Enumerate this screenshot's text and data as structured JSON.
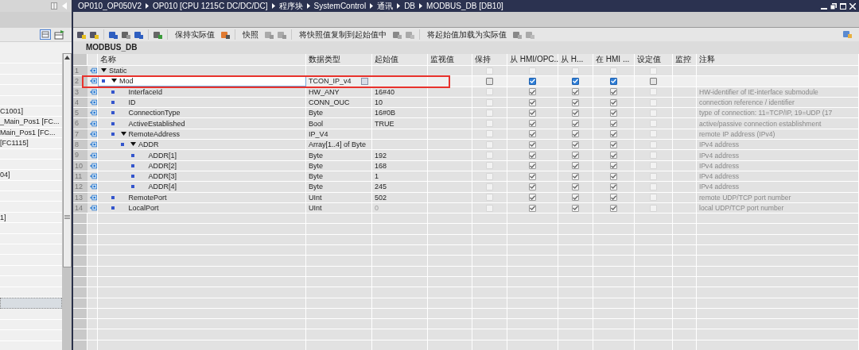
{
  "breadcrumb": [
    "OP010_OP050V2",
    "OP010 [CPU 1215C DC/DC/DC]",
    "程序块",
    "SystemControl",
    "通讯",
    "DB",
    "MODBUS_DB [DB10]"
  ],
  "toolbar": {
    "labels": [
      "保持实际值",
      "快照",
      "将快照值复制到起始值中",
      "将起始值加载为实际值"
    ]
  },
  "left_panel": {
    "items": [
      {
        "kind": "blank",
        "selected": false
      },
      {
        "kind": "blank",
        "selected": false
      },
      {
        "kind": "blank",
        "selected": false
      },
      {
        "kind": "blank",
        "selected": false
      },
      {
        "kind": "blank",
        "selected": false
      },
      {
        "kind": "text",
        "text": "C1001]",
        "selected": false
      },
      {
        "kind": "text",
        "text": "_Main_Pos1 [FC...",
        "selected": false
      },
      {
        "kind": "text",
        "text": "Main_Pos1 [FC...",
        "selected": false
      },
      {
        "kind": "text",
        "text": "[FC1115]",
        "selected": false
      },
      {
        "kind": "blank",
        "selected": false
      },
      {
        "kind": "blank",
        "selected": false
      },
      {
        "kind": "text",
        "text": "04]",
        "selected": false
      },
      {
        "kind": "blank",
        "selected": false
      },
      {
        "kind": "blank",
        "selected": false
      },
      {
        "kind": "blank",
        "selected": false
      },
      {
        "kind": "text",
        "text": "1]",
        "selected": false
      },
      {
        "kind": "blank",
        "selected": false
      },
      {
        "kind": "blank",
        "selected": false
      },
      {
        "kind": "blank",
        "selected": false
      },
      {
        "kind": "blank",
        "selected": false
      },
      {
        "kind": "blank",
        "selected": false
      },
      {
        "kind": "blank",
        "selected": false
      },
      {
        "kind": "blank",
        "selected": false
      },
      {
        "kind": "blank",
        "selected": true
      },
      {
        "kind": "blank",
        "selected": false
      },
      {
        "kind": "blank",
        "selected": false
      },
      {
        "kind": "blank",
        "selected": false
      },
      {
        "kind": "blank",
        "selected": false
      }
    ]
  },
  "editor": {
    "title": "MODBUS_DB",
    "columns": [
      "名称",
      "数据类型",
      "起始值",
      "监视值",
      "保持",
      "从 HMI/OPC..",
      "从 H...",
      "在 HMI ...",
      "设定值",
      "监控",
      "注释"
    ],
    "rows": [
      {
        "num": "1",
        "name": "Static",
        "expanded": true,
        "selected": false,
        "checks": [
          {
            "checked": false,
            "disabled": true
          },
          {
            "checked": false,
            "disabled": true
          },
          {
            "checked": false,
            "disabled": true
          },
          {
            "checked": false,
            "disabled": true
          },
          {
            "checked": false,
            "disabled": true
          }
        ],
        "children": [
          {
            "num": "2",
            "name": "Mod",
            "type": "TCON_IP_v4",
            "expanded": true,
            "selected": true,
            "checks": [
              {
                "checked": false,
                "disabled": false
              },
              {
                "checked": true,
                "disabled": false
              },
              {
                "checked": true,
                "disabled": false
              },
              {
                "checked": true,
                "disabled": false
              },
              {
                "checked": false,
                "disabled": false
              }
            ],
            "children": [
              {
                "num": "3",
                "name": "InterfaceId",
                "type": "HW_ANY",
                "start": "16#40",
                "start_dimmed": false,
                "comment": "HW-identifier of IE-interface submodule",
                "selected": false,
                "checks": [
                  {
                    "checked": false,
                    "disabled": true
                  },
                  {
                    "checked": true,
                    "disabled": true
                  },
                  {
                    "checked": true,
                    "disabled": true
                  },
                  {
                    "checked": true,
                    "disabled": true
                  },
                  {
                    "checked": false,
                    "disabled": true
                  }
                ]
              },
              {
                "num": "4",
                "name": "ID",
                "type": "CONN_OUC",
                "start": "10",
                "start_dimmed": false,
                "comment": "connection reference / identifier",
                "selected": false,
                "checks": [
                  {
                    "checked": false,
                    "disabled": true
                  },
                  {
                    "checked": true,
                    "disabled": true
                  },
                  {
                    "checked": true,
                    "disabled": true
                  },
                  {
                    "checked": true,
                    "disabled": true
                  },
                  {
                    "checked": false,
                    "disabled": true
                  }
                ]
              },
              {
                "num": "5",
                "name": "ConnectionType",
                "type": "Byte",
                "start": "16#0B",
                "start_dimmed": false,
                "comment": "type of connection: 11=TCP/IP, 19=UDP (17",
                "selected": false,
                "checks": [
                  {
                    "checked": false,
                    "disabled": true
                  },
                  {
                    "checked": true,
                    "disabled": true
                  },
                  {
                    "checked": true,
                    "disabled": true
                  },
                  {
                    "checked": true,
                    "disabled": true
                  },
                  {
                    "checked": false,
                    "disabled": true
                  }
                ]
              },
              {
                "num": "6",
                "name": "ActiveEstablished",
                "type": "Bool",
                "start": "TRUE",
                "start_dimmed": false,
                "comment": "active/passive connection establishment",
                "selected": false,
                "checks": [
                  {
                    "checked": false,
                    "disabled": true
                  },
                  {
                    "checked": true,
                    "disabled": true
                  },
                  {
                    "checked": true,
                    "disabled": true
                  },
                  {
                    "checked": true,
                    "disabled": true
                  },
                  {
                    "checked": false,
                    "disabled": true
                  }
                ]
              },
              {
                "num": "7",
                "name": "RemoteAddress",
                "type": "IP_V4",
                "comment": "remote IP address (IPv4)",
                "expanded": true,
                "selected": false,
                "checks": [
                  {
                    "checked": false,
                    "disabled": true
                  },
                  {
                    "checked": true,
                    "disabled": true
                  },
                  {
                    "checked": true,
                    "disabled": true
                  },
                  {
                    "checked": true,
                    "disabled": true
                  },
                  {
                    "checked": false,
                    "disabled": true
                  }
                ],
                "children": [
                  {
                    "num": "8",
                    "name": "ADDR",
                    "type": "Array[1..4] of Byte",
                    "comment": "IPv4 address",
                    "expanded": true,
                    "selected": false,
                    "checks": [
                      {
                        "checked": false,
                        "disabled": true
                      },
                      {
                        "checked": true,
                        "disabled": true
                      },
                      {
                        "checked": true,
                        "disabled": true
                      },
                      {
                        "checked": true,
                        "disabled": true
                      },
                      {
                        "checked": false,
                        "disabled": true
                      }
                    ],
                    "children": [
                      {
                        "num": "9",
                        "name": "ADDR[1]",
                        "type": "Byte",
                        "start": "192",
                        "start_dimmed": false,
                        "comment": "IPv4 address",
                        "selected": false,
                        "checks": [
                          {
                            "checked": false,
                            "disabled": true
                          },
                          {
                            "checked": true,
                            "disabled": true
                          },
                          {
                            "checked": true,
                            "disabled": true
                          },
                          {
                            "checked": true,
                            "disabled": true
                          },
                          {
                            "checked": false,
                            "disabled": true
                          }
                        ]
                      },
                      {
                        "num": "10",
                        "name": "ADDR[2]",
                        "type": "Byte",
                        "start": "168",
                        "start_dimmed": false,
                        "comment": "IPv4 address",
                        "selected": false,
                        "checks": [
                          {
                            "checked": false,
                            "disabled": true
                          },
                          {
                            "checked": true,
                            "disabled": true
                          },
                          {
                            "checked": true,
                            "disabled": true
                          },
                          {
                            "checked": true,
                            "disabled": true
                          },
                          {
                            "checked": false,
                            "disabled": true
                          }
                        ]
                      },
                      {
                        "num": "11",
                        "name": "ADDR[3]",
                        "type": "Byte",
                        "start": "1",
                        "start_dimmed": false,
                        "comment": "IPv4 address",
                        "selected": false,
                        "checks": [
                          {
                            "checked": false,
                            "disabled": true
                          },
                          {
                            "checked": true,
                            "disabled": true
                          },
                          {
                            "checked": true,
                            "disabled": true
                          },
                          {
                            "checked": true,
                            "disabled": true
                          },
                          {
                            "checked": false,
                            "disabled": true
                          }
                        ]
                      },
                      {
                        "num": "12",
                        "name": "ADDR[4]",
                        "type": "Byte",
                        "start": "245",
                        "start_dimmed": false,
                        "comment": "IPv4 address",
                        "selected": false,
                        "checks": [
                          {
                            "checked": false,
                            "disabled": true
                          },
                          {
                            "checked": true,
                            "disabled": true
                          },
                          {
                            "checked": true,
                            "disabled": true
                          },
                          {
                            "checked": true,
                            "disabled": true
                          },
                          {
                            "checked": false,
                            "disabled": true
                          }
                        ]
                      }
                    ]
                  }
                ]
              },
              {
                "num": "13",
                "name": "RemotePort",
                "type": "UInt",
                "start": "502",
                "start_dimmed": false,
                "comment": "remote UDP/TCP port number",
                "selected": false,
                "checks": [
                  {
                    "checked": false,
                    "disabled": true
                  },
                  {
                    "checked": true,
                    "disabled": true
                  },
                  {
                    "checked": true,
                    "disabled": true
                  },
                  {
                    "checked": true,
                    "disabled": true
                  },
                  {
                    "checked": false,
                    "disabled": true
                  }
                ]
              },
              {
                "num": "14",
                "name": "LocalPort",
                "type": "UInt",
                "start": "0",
                "start_dimmed": true,
                "comment": "local UDP/TCP port number",
                "selected": false,
                "checks": [
                  {
                    "checked": false,
                    "disabled": true
                  },
                  {
                    "checked": true,
                    "disabled": true
                  },
                  {
                    "checked": true,
                    "disabled": true
                  },
                  {
                    "checked": true,
                    "disabled": true
                  },
                  {
                    "checked": false,
                    "disabled": true
                  }
                ]
              }
            ]
          }
        ]
      }
    ]
  }
}
